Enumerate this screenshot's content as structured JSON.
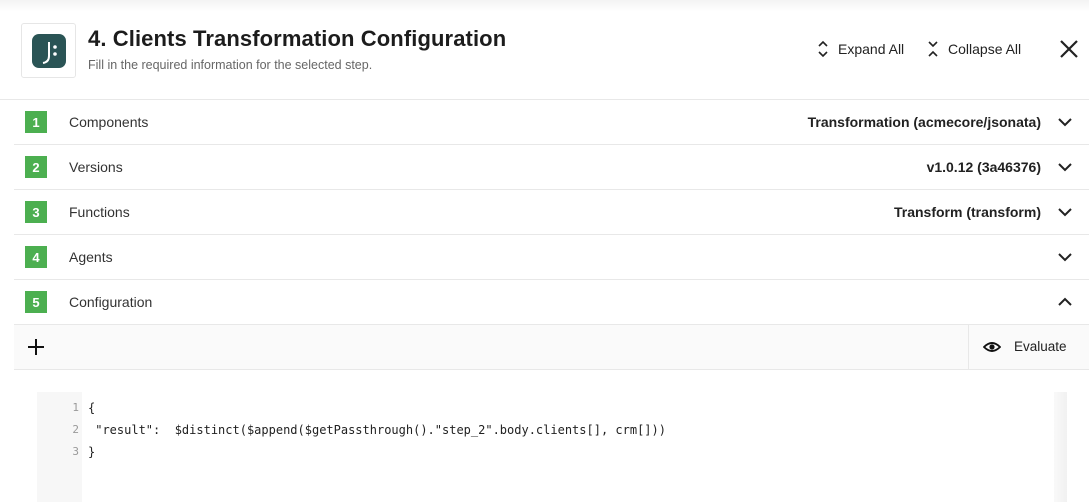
{
  "header": {
    "title": "4. Clients Transformation Configuration",
    "subtitle": "Fill in the required information for the selected step.",
    "logo_icon": "jsonata-logo",
    "expand_all_label": "Expand All",
    "collapse_all_label": "Collapse All",
    "close_icon": "close-icon"
  },
  "steps": [
    {
      "number": "1",
      "label": "Components",
      "value": "Transformation (acmecore/jsonata)",
      "expanded": false
    },
    {
      "number": "2",
      "label": "Versions",
      "value": "v1.0.12 (3a46376)",
      "expanded": false
    },
    {
      "number": "3",
      "label": "Functions",
      "value": "Transform (transform)",
      "expanded": false
    },
    {
      "number": "4",
      "label": "Agents",
      "value": "",
      "expanded": false
    },
    {
      "number": "5",
      "label": "Configuration",
      "value": "",
      "expanded": true
    }
  ],
  "toolbar": {
    "add_icon": "plus-icon",
    "evaluate_label": "Evaluate",
    "evaluate_icon": "eye-icon"
  },
  "editor": {
    "lines": [
      {
        "number": "1",
        "code": "{"
      },
      {
        "number": "2",
        "code": " \"result\":  $distinct($append($getPassthrough().\"step_2\".body.clients[], crm[]))"
      },
      {
        "number": "3",
        "code": "}"
      }
    ]
  },
  "colors": {
    "step_badge": "#4caf50",
    "logo_bg": "#2a5455"
  }
}
